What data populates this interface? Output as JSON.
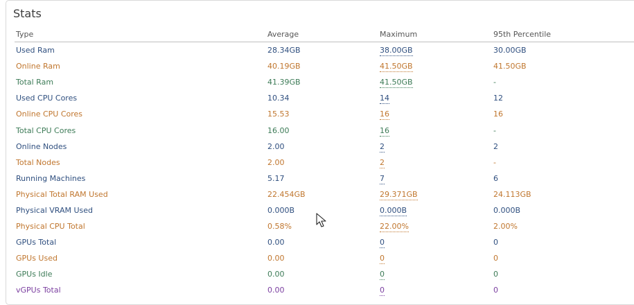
{
  "title": "Stats",
  "columns": [
    "Type",
    "Average",
    "Maximum",
    "95th Percentile"
  ],
  "colors": {
    "blue": "#2f4f7f",
    "orange": "#c0762e",
    "green": "#3d7b57",
    "purple": "#7b3fa0"
  },
  "rows": [
    {
      "type": "Used Ram",
      "avg": "28.34GB",
      "max": "38.00GB",
      "p95": "30.00GB",
      "color": "#2f4f7f"
    },
    {
      "type": "Online Ram",
      "avg": "40.19GB",
      "max": "41.50GB",
      "p95": "41.50GB",
      "color": "#c0762e"
    },
    {
      "type": "Total Ram",
      "avg": "41.39GB",
      "max": "41.50GB",
      "p95": "-",
      "color": "#3d7b57"
    },
    {
      "type": "Used CPU Cores",
      "avg": "10.34",
      "max": "14",
      "p95": "12",
      "color": "#2f4f7f"
    },
    {
      "type": "Online CPU Cores",
      "avg": "15.53",
      "max": "16",
      "p95": "16",
      "color": "#c0762e"
    },
    {
      "type": "Total CPU Cores",
      "avg": "16.00",
      "max": "16",
      "p95": "-",
      "color": "#3d7b57"
    },
    {
      "type": "Online Nodes",
      "avg": "2.00",
      "max": "2",
      "p95": "2",
      "color": "#2f4f7f"
    },
    {
      "type": "Total Nodes",
      "avg": "2.00",
      "max": "2",
      "p95": "-",
      "color": "#c0762e"
    },
    {
      "type": "Running Machines",
      "avg": "5.17",
      "max": "7",
      "p95": "6",
      "color": "#2f4f7f"
    },
    {
      "type": "Physical Total RAM Used",
      "avg": "22.454GB",
      "max": "29.371GB",
      "p95": "24.113GB",
      "color": "#c0762e"
    },
    {
      "type": "Physical VRAM Used",
      "avg": "0.000B",
      "max": "0.000B",
      "p95": "0.000B",
      "color": "#2f4f7f"
    },
    {
      "type": "Physical CPU Total",
      "avg": "0.58%",
      "max": "22.00%",
      "p95": "2.00%",
      "color": "#c0762e"
    },
    {
      "type": "GPUs Total",
      "avg": "0.00",
      "max": "0",
      "p95": "0",
      "color": "#2f4f7f"
    },
    {
      "type": "GPUs Used",
      "avg": "0.00",
      "max": "0",
      "p95": "0",
      "color": "#c0762e"
    },
    {
      "type": "GPUs Idle",
      "avg": "0.00",
      "max": "0",
      "p95": "0",
      "color": "#3d7b57"
    },
    {
      "type": "vGPUs Total",
      "avg": "0.00",
      "max": "0",
      "p95": "0",
      "color": "#7b3fa0"
    }
  ]
}
